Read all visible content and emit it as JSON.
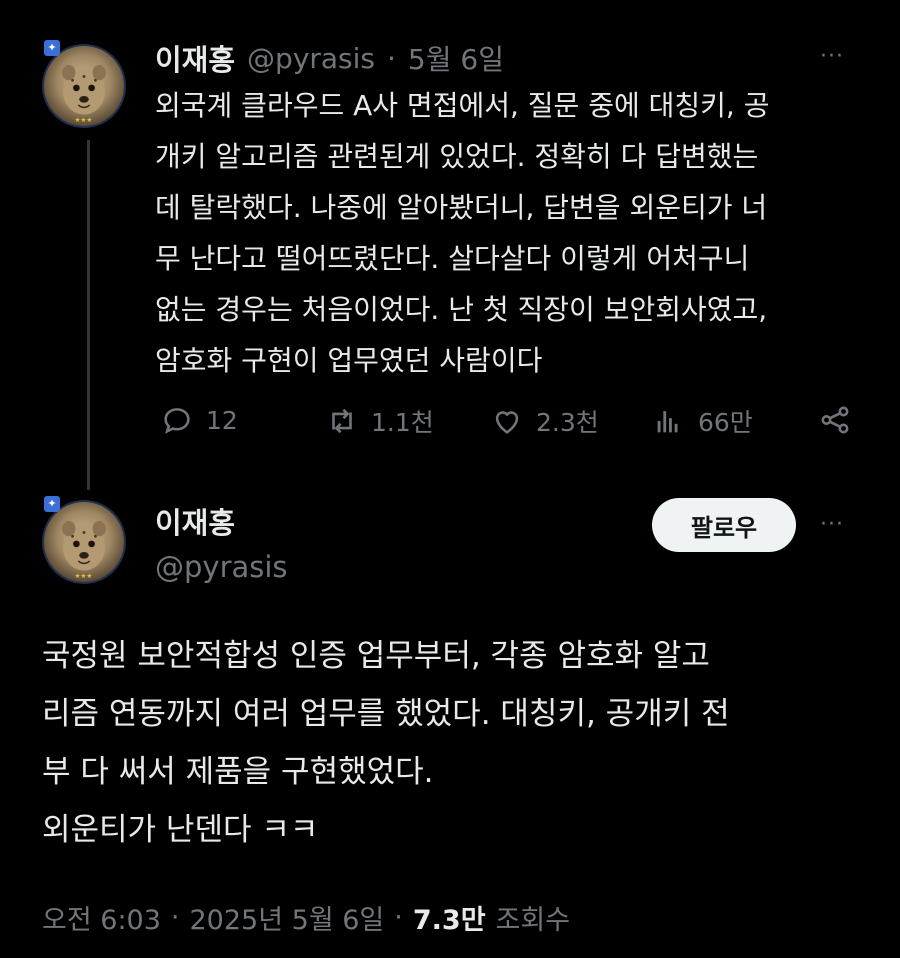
{
  "reply_tweet": {
    "author_name": "이재홍",
    "handle": "@pyrasis",
    "date": "5월 6일",
    "separator": "·",
    "more": "···",
    "text": "외국계 클라우드 A사 면접에서, 질문 중에 대칭키, 공\n개키 알고리즘 관련된게 있었다. 정확히 다 답변했는\n데 탈락했다. 나중에 알아봤더니, 답변을 외운티가 너\n무 난다고 떨어뜨렸단다. 살다살다 이렇게 어처구니\n없는 경우는 처음이었다. 난 첫 직장이 보안회사였고,\n암호화 구현이 업무였던 사람이다",
    "actions": {
      "replies": "12",
      "retweets": "1.1천",
      "likes": "2.3천",
      "views": "66만"
    }
  },
  "main_tweet": {
    "author_name": "이재홍",
    "handle": "@pyrasis",
    "follow_label": "팔로우",
    "more": "···",
    "text": "국정원 보안적합성 인증 업무부터, 각종 암호화 알고\n리즘 연동까지 여러 업무를 했었다. 대칭키, 공개키 전\n부 다 써서 제품을 구현했었다.\n외운티가 난덴다 ㅋㅋ",
    "time": "오전 6:03",
    "separator1": "·",
    "date": "2025년 5월 6일",
    "separator2": "·",
    "views_count": "7.3만",
    "views_label": "조회수"
  },
  "colors": {
    "background": "#000000",
    "text": "#e7e9ea",
    "muted": "#71767b",
    "follow_bg": "#eff3f4"
  },
  "icons": [
    "reply-icon",
    "retweet-icon",
    "like-icon",
    "views-icon",
    "share-icon",
    "more-icon"
  ]
}
